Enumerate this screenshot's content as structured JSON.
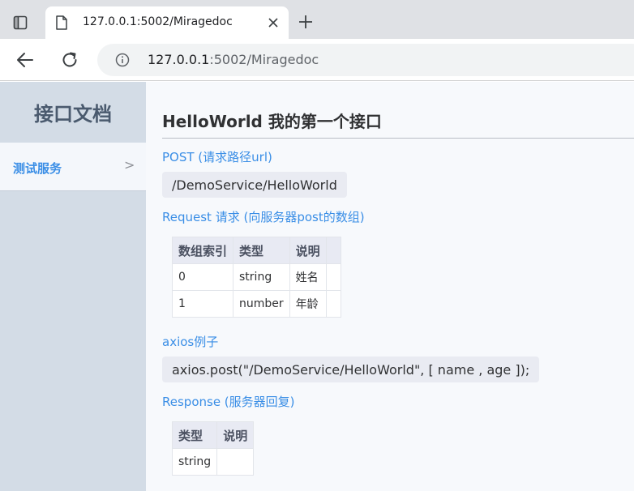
{
  "browser": {
    "tab_title": "127.0.0.1:5002/Miragedoc",
    "url_host": "127.0.0.1",
    "url_rest": ":5002/Miragedoc",
    "icons": [
      "window-icon",
      "page-icon",
      "close-icon",
      "plus-icon",
      "back-icon",
      "reload-icon",
      "info-icon"
    ]
  },
  "sidebar": {
    "title": "接口文档",
    "items": [
      {
        "label": "测试服务",
        "chevron": ">"
      }
    ]
  },
  "main": {
    "title": "HelloWorld 我的第一个接口",
    "method_label": "POST (请求路径url)",
    "path": "/DemoService/HelloWorld",
    "request_label": "Request 请求 (向服务器post的数组)",
    "request_table": {
      "headers": [
        "数组索引",
        "类型",
        "说明"
      ],
      "rows": [
        [
          "0",
          "string",
          "姓名"
        ],
        [
          "1",
          "number",
          "年龄"
        ]
      ]
    },
    "axios_label": "axios例子",
    "axios_code": "axios.post(\"/DemoService/HelloWorld\", [ name , age ]);",
    "response_label": "Response (服务器回复)",
    "response_table": {
      "headers": [
        "类型",
        "说明"
      ],
      "rows": [
        [
          "string",
          ""
        ]
      ]
    }
  },
  "colors": {
    "accent": "#3a8ee6",
    "sidebar_bg": "#d3dce6",
    "main_bg": "#f7f9fc"
  }
}
